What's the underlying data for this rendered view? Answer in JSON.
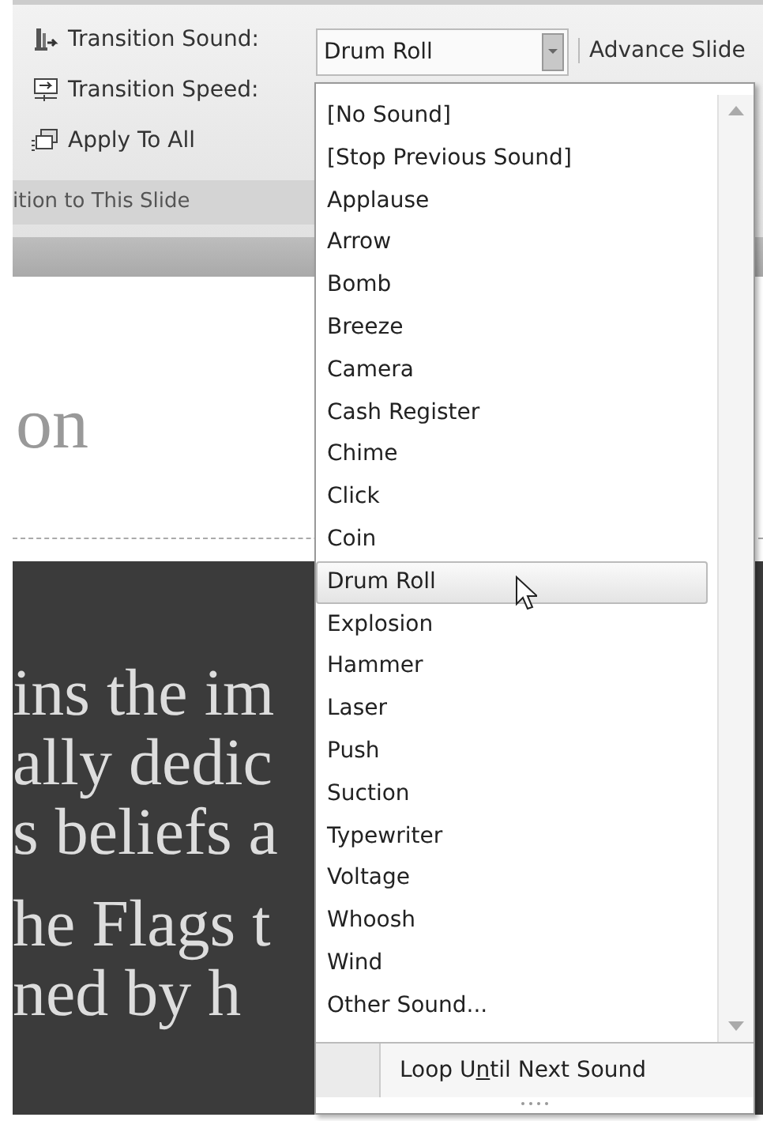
{
  "ribbon": {
    "commands": [
      {
        "kind": "sound",
        "label": "Transition Sound:"
      },
      {
        "kind": "speed",
        "label": "Transition Speed:"
      },
      {
        "kind": "apply",
        "label": "Apply To All"
      }
    ],
    "sound_combo": {
      "value": "Drum Roll"
    },
    "advance_label": "Advance Slide",
    "group_label": "ition to This Slide"
  },
  "slide": {
    "title": "on",
    "lines": [
      "ins the im",
      "ally dedic",
      "s beliefs a",
      "he Flags t",
      "ned by h"
    ]
  },
  "dropdown": {
    "items": [
      {
        "label": "[No Sound]",
        "selected": false
      },
      {
        "label": "[Stop Previous Sound]",
        "selected": false
      },
      {
        "label": "Applause",
        "selected": false
      },
      {
        "label": "Arrow",
        "selected": false
      },
      {
        "label": "Bomb",
        "selected": false
      },
      {
        "label": "Breeze",
        "selected": false
      },
      {
        "label": "Camera",
        "selected": false
      },
      {
        "label": "Cash Register",
        "selected": false
      },
      {
        "label": "Chime",
        "selected": false
      },
      {
        "label": "Click",
        "selected": false
      },
      {
        "label": "Coin",
        "selected": false
      },
      {
        "label": "Drum Roll",
        "selected": true
      },
      {
        "label": "Explosion",
        "selected": false
      },
      {
        "label": "Hammer",
        "selected": false
      },
      {
        "label": "Laser",
        "selected": false
      },
      {
        "label": "Push",
        "selected": false
      },
      {
        "label": "Suction",
        "selected": false
      },
      {
        "label": "Typewriter",
        "selected": false
      },
      {
        "label": "Voltage",
        "selected": false
      },
      {
        "label": "Whoosh",
        "selected": false
      },
      {
        "label": "Wind",
        "selected": false
      },
      {
        "label": "Other Sound...",
        "selected": false
      }
    ],
    "loop_option": {
      "label_parts": [
        "Loop U",
        "n",
        "til Next Sound"
      ],
      "checked": false
    }
  }
}
